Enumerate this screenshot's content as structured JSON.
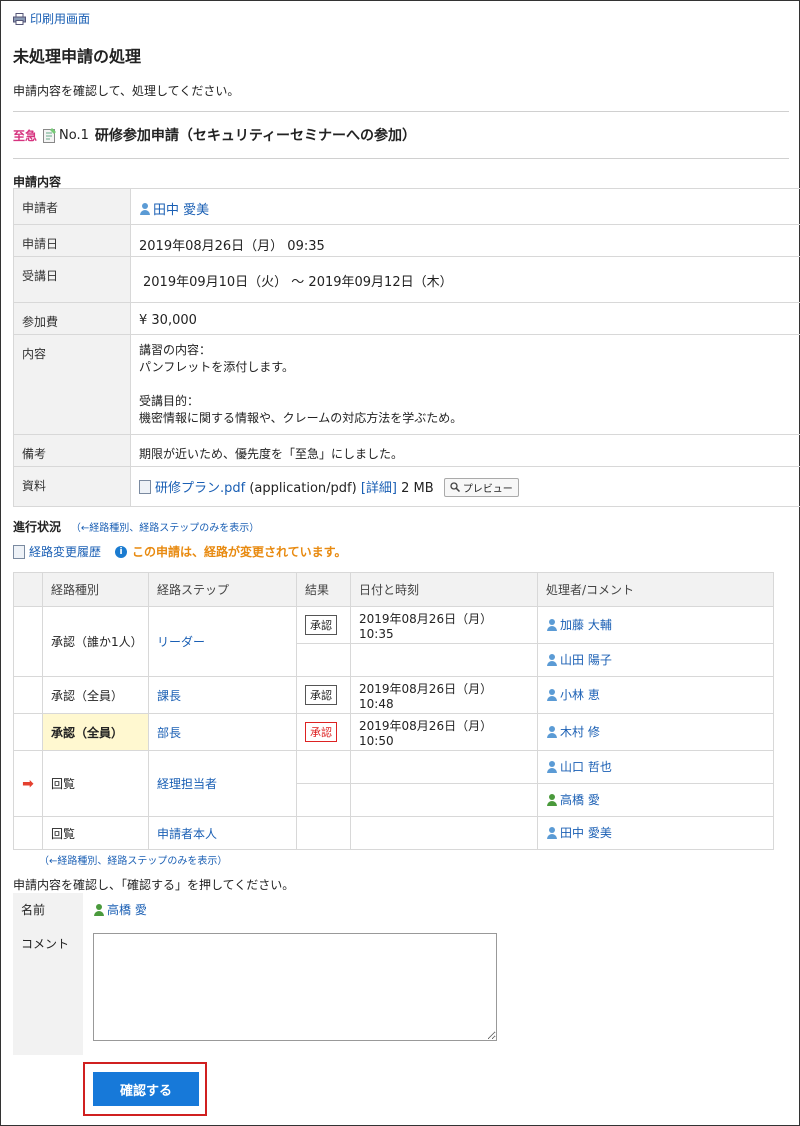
{
  "print_link": "印刷用画面",
  "page_title": "未処理申請の処理",
  "instruction": "申請内容を確認して、処理してください。",
  "request": {
    "urgent": "至急",
    "number": "No.1",
    "title": "研修参加申請（セキュリティーセミナーへの参加）"
  },
  "details_heading": "申請内容",
  "details": {
    "applicant_label": "申請者",
    "applicant": "田中 愛美",
    "date_label": "申請日",
    "date": "2019年08月26日（月） 09:35",
    "course_label": "受講日",
    "course_date": "2019年09月10日（火） 〜 2019年09月12日（木）",
    "fee_label": "参加費",
    "fee": "¥ 30,000",
    "content_label": "内容",
    "content_line1": "講習の内容：",
    "content_line2": "パンフレットを添付します。",
    "content_line3": "受講目的：",
    "content_line4": "機密情報に関する情報や、クレームの対応方法を学ぶため。",
    "remarks_label": "備考",
    "remarks": "期限が近いため、優先度を「至急」にしました。",
    "file_label": "資料",
    "file_name": "研修プラン.pdf",
    "file_type": "(application/pdf)",
    "file_detail": "[詳細]",
    "file_size": "2 MB",
    "preview": "プレビュー"
  },
  "progress": {
    "heading": "進行状況",
    "toggle": "（←経路種別、経路ステップのみを表示）",
    "history_link": "経路変更履歴",
    "warning": "この申請は、経路が変更されています。"
  },
  "route_headers": [
    "経路種別",
    "経路ステップ",
    "結果",
    "日付と時刻",
    "処理者/コメント"
  ],
  "route": {
    "r1_type": "承認（誰か1人）",
    "r1_step": "リーダー",
    "r1_result": "承認",
    "r1_date": "2019年08月26日（月） 10:35",
    "r1_user_a": "加藤 大輔",
    "r1_user_b": "山田 陽子",
    "r2_type": "承認（全員）",
    "r2_step": "課長",
    "r2_result": "承認",
    "r2_date": "2019年08月26日（月） 10:48",
    "r2_user": "小林 恵",
    "r3_type": "承認（全員）",
    "r3_step": "部長",
    "r3_result": "承認",
    "r3_date": "2019年08月26日（月） 10:50",
    "r3_user": "木村 修",
    "r4_type": "回覧",
    "r4_step": "経理担当者",
    "r4_user_a": "山口 哲也",
    "r4_user_b": "高橋 愛",
    "r5_type": "回覧",
    "r5_step": "申請者本人",
    "r5_user": "田中 愛美"
  },
  "bottom_toggle": "（←経路種別、経路ステップのみを表示）",
  "confirm_instruction": "申請内容を確認し、「確認する」を押してください。",
  "form": {
    "name_label": "名前",
    "name_value": "高橋 愛",
    "comment_label": "コメント",
    "comment_value": ""
  },
  "confirm_button": "確認する"
}
